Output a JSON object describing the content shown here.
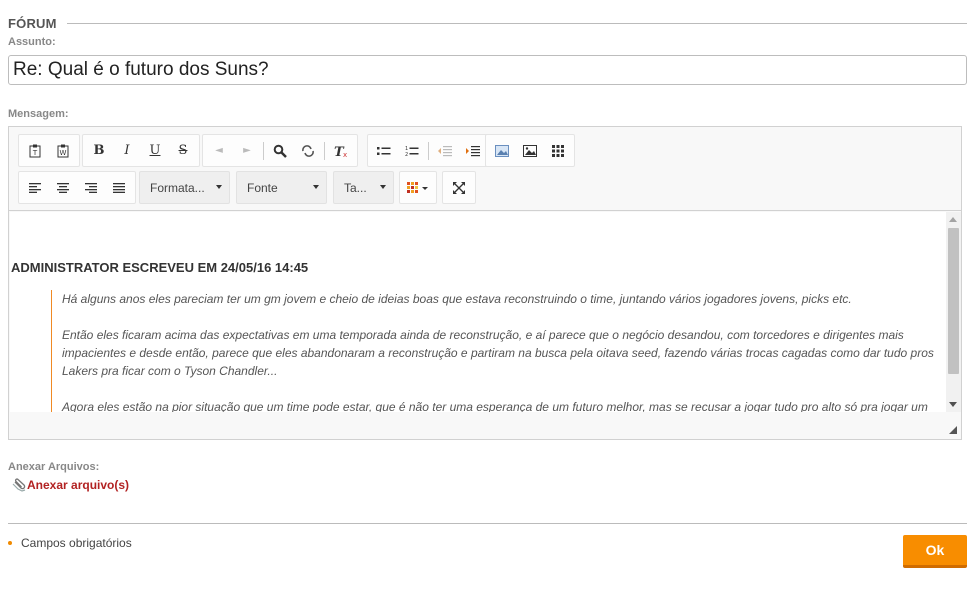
{
  "form": {
    "legend": "FÓRUM",
    "subject_label": "Assunto:",
    "subject_value": "Re: Qual é o futuro dos Suns?",
    "message_label": "Mensagem:"
  },
  "editor": {
    "toolbar": {
      "format_combo": "Formata...",
      "font_combo": "Fonte",
      "size_combo": "Ta..."
    },
    "content": {
      "quote_header": "ADMINISTRATOR ESCREVEU EM 24/05/16 14:45",
      "paragraphs": [
        "Há alguns anos eles pareciam ter um gm jovem e cheio de ideias boas que estava reconstruindo o time, juntando vários jogadores jovens, picks etc.",
        "Então eles ficaram acima das expectativas em uma temporada ainda de reconstrução, e aí parece que o negócio desandou, com torcedores e dirigentes mais impacientes e desde então, parece que eles abandonaram a reconstrução e partiram na busca pela oitava seed, fazendo várias trocas cagadas como dar tudo pros Lakers pra ficar com o Tyson Chandler...",
        "Agora eles estão na pior situação que um time pode estar, que é não ter uma esperança de um futuro melhor, mas se recusar a jogar tudo pro alto só pra jogar um"
      ]
    }
  },
  "attachments": {
    "label": "Anexar Arquivos:",
    "link": "Anexar arquivo(s)"
  },
  "footer": {
    "required_note": "Campos obrigatórios",
    "ok_button": "Ok"
  },
  "colors": {
    "accent": "#f88d00",
    "link": "#b22222",
    "quote_border": "#f08a24"
  }
}
